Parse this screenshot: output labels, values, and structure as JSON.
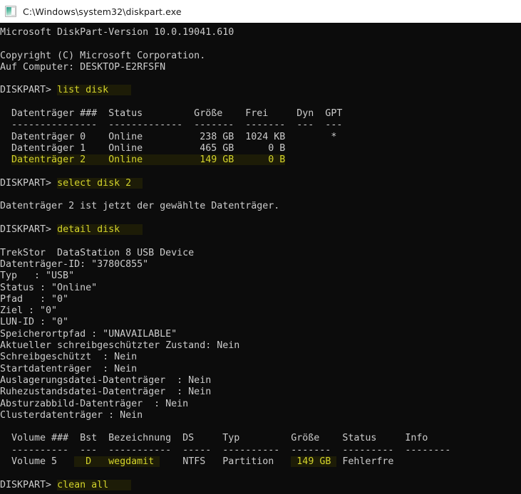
{
  "window": {
    "title": "C:\\Windows\\system32\\diskpart.exe",
    "icon": "console-window-icon",
    "titlebar_bg": "#ffffff",
    "console_bg": "#0c0c0c",
    "text_color": "#cccccc",
    "highlight_color": "#d4d42b",
    "highlight_bg": "#1d1c07"
  },
  "terminal": {
    "prompt": "DISKPART>",
    "lines": [
      {
        "id": "version",
        "text": "Microsoft DiskPart-Version 10.0.19041.610"
      },
      {
        "id": "blank-1",
        "text": ""
      },
      {
        "id": "copyright",
        "text": "Copyright (C) Microsoft Corporation."
      },
      {
        "id": "computer",
        "text": "Auf Computer: DESKTOP-E2RFSFN"
      },
      {
        "id": "blank-2",
        "text": ""
      },
      {
        "id": "cmd-list-disk",
        "text": "DISKPART> list disk",
        "prompt": "DISKPART> ",
        "command": "list disk",
        "hl_pad": 4
      },
      {
        "id": "blank-3",
        "text": ""
      },
      {
        "id": "disk-hdr",
        "text": "  Datenträger ###  Status         Größe    Frei     Dyn  GPT"
      },
      {
        "id": "disk-sep",
        "text": "  ---------------  -------------  -------  -------  ---  ---"
      },
      {
        "id": "disk-row-0",
        "text": "  Datenträger 0    Online          238 GB  1024 KB        *"
      },
      {
        "id": "disk-row-1",
        "text": "  Datenträger 1    Online          465 GB      0 B"
      },
      {
        "id": "disk-row-2",
        "text": "  Datenträger 2    Online          149 GB      0 B",
        "highlight": true,
        "hl_start": 2,
        "hl_end": 54
      },
      {
        "id": "blank-4",
        "text": ""
      },
      {
        "id": "cmd-select-disk",
        "text": "DISKPART> select disk 2",
        "prompt": "DISKPART> ",
        "command": "select disk 2",
        "hl_pad": 2
      },
      {
        "id": "blank-5",
        "text": ""
      },
      {
        "id": "selected-msg",
        "text": "Datenträger 2 ist jetzt der gewählte Datenträger."
      },
      {
        "id": "blank-6",
        "text": ""
      },
      {
        "id": "cmd-detail-disk",
        "text": "DISKPART> detail disk",
        "prompt": "DISKPART> ",
        "command": "detail disk",
        "hl_pad": 4
      },
      {
        "id": "blank-7",
        "text": ""
      },
      {
        "id": "dev-name",
        "text": "TrekStor  DataStation 8 USB Device"
      },
      {
        "id": "disk-id",
        "text": "Datenträger-ID: \"3780C855\""
      },
      {
        "id": "typ",
        "text": "Typ   : \"USB\""
      },
      {
        "id": "status",
        "text": "Status : \"Online\""
      },
      {
        "id": "pfad",
        "text": "Pfad   : \"0\""
      },
      {
        "id": "ziel",
        "text": "Ziel : \"0\""
      },
      {
        "id": "lun-id",
        "text": "LUN-ID : \"0\""
      },
      {
        "id": "speicherortpfad",
        "text": "Speicherortpfad : \"UNAVAILABLE\""
      },
      {
        "id": "akt-schreib",
        "text": "Aktueller schreibgeschützter Zustand: Nein"
      },
      {
        "id": "schreibgesch",
        "text": "Schreibgeschützt  : Nein"
      },
      {
        "id": "startdt",
        "text": "Startdatenträger  : Nein"
      },
      {
        "id": "auslagerung",
        "text": "Auslagerungsdatei-Datenträger  : Nein"
      },
      {
        "id": "ruhezustand",
        "text": "Ruhezustandsdatei-Datenträger  : Nein"
      },
      {
        "id": "absturz",
        "text": "Absturzabbild-Datenträger  : Nein"
      },
      {
        "id": "cluster",
        "text": "Clusterdatenträger : Nein"
      },
      {
        "id": "blank-8",
        "text": ""
      },
      {
        "id": "vol-hdr",
        "text": "  Volume ###  Bst  Bezeichnung  DS     Typ         Größe    Status     Info"
      },
      {
        "id": "vol-sep",
        "text": "  ----------  ---  -----------  -----  ----------  -------  ---------  --------"
      },
      {
        "id": "vol-row-5",
        "text": "  Volume 5     D   wegdamit     NTFS   Partition    149 GB  Fehlerfre",
        "vol_highlight": true
      },
      {
        "id": "blank-9",
        "text": ""
      },
      {
        "id": "cmd-clean-all",
        "text": "DISKPART> clean all",
        "prompt": "DISKPART> ",
        "command": "clean all",
        "hl_pad": 4
      }
    ],
    "disk_table": {
      "headers": [
        "Datenträger ###",
        "Status",
        "Größe",
        "Frei",
        "Dyn",
        "GPT"
      ],
      "rows": [
        {
          "disk": "Datenträger 0",
          "status": "Online",
          "size": "238 GB",
          "free": "1024 KB",
          "dyn": "",
          "gpt": "*",
          "selected": false
        },
        {
          "disk": "Datenträger 1",
          "status": "Online",
          "size": "465 GB",
          "free": "0 B",
          "dyn": "",
          "gpt": "",
          "selected": false
        },
        {
          "disk": "Datenträger 2",
          "status": "Online",
          "size": "149 GB",
          "free": "0 B",
          "dyn": "",
          "gpt": "",
          "selected": true
        }
      ]
    },
    "volume_table": {
      "headers": [
        "Volume ###",
        "Bst",
        "Bezeichnung",
        "DS",
        "Typ",
        "Größe",
        "Status",
        "Info"
      ],
      "rows": [
        {
          "volume": "Volume 5",
          "letter": "D",
          "label": "wegdamit",
          "fs": "NTFS",
          "type": "Partition",
          "size": "149 GB",
          "status": "Fehlerfre",
          "info": ""
        }
      ]
    },
    "detail_disk": {
      "device": "TrekStor  DataStation 8 USB Device",
      "disk_id": "3780C855",
      "typ": "USB",
      "status": "Online",
      "pfad": "0",
      "ziel": "0",
      "lun_id": "0",
      "speicherortpfad": "UNAVAILABLE",
      "aktueller_schreibgeschuetzter_zustand": "Nein",
      "schreibgeschuetzt": "Nein",
      "startdatentraeger": "Nein",
      "auslagerungsdatei_datentraeger": "Nein",
      "ruhezustandsdatei_datentraeger": "Nein",
      "absturzabbild_datentraeger": "Nein",
      "clusterdatentraeger": "Nein"
    },
    "commands": [
      "list disk",
      "select disk 2",
      "detail disk",
      "clean all"
    ]
  }
}
